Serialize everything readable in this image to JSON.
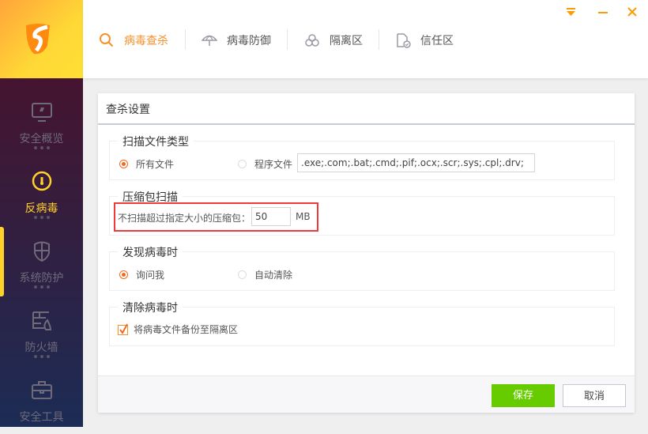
{
  "app": {
    "logo": "S shield logo"
  },
  "window_controls": {
    "menu_icon": "dropdown-menu-icon",
    "minimize_icon": "minimize-icon",
    "close_icon": "close-icon",
    "accent": "#ff9a00"
  },
  "top_tabs": [
    {
      "label": "病毒查杀",
      "icon": "search-icon",
      "active": true
    },
    {
      "label": "病毒防御",
      "icon": "umbrella-icon",
      "active": false
    },
    {
      "label": "隔离区",
      "icon": "biohazard-icon",
      "active": false
    },
    {
      "label": "信任区",
      "icon": "trusted-file-icon",
      "active": false
    }
  ],
  "sidebar": {
    "items": [
      {
        "label": "安全概览",
        "icon": "monitor-icon",
        "active": false
      },
      {
        "label": "反病毒",
        "icon": "gauge-icon",
        "active": true
      },
      {
        "label": "系统防护",
        "icon": "shield-icon",
        "active": false
      },
      {
        "label": "防火墙",
        "icon": "firewall-icon",
        "active": false
      },
      {
        "label": "安全工具",
        "icon": "toolbox-icon",
        "active": false
      }
    ]
  },
  "panel": {
    "title": "查杀设置",
    "scan_types": {
      "legend": "扫描文件类型",
      "option_all": "所有文件",
      "option_program": "程序文件",
      "selected": "所有文件",
      "extensions": ".exe;.com;.bat;.cmd;.pif;.ocx;.scr;.sys;.cpl;.drv;"
    },
    "archive": {
      "legend": "压缩包扫描",
      "label": "不扫描超过指定大小的压缩包：",
      "value": "50",
      "unit": "MB"
    },
    "on_found": {
      "legend": "发现病毒时",
      "option_ask": "询问我",
      "option_auto": "自动清除",
      "selected": "询问我"
    },
    "on_clean": {
      "legend": "清除病毒时",
      "backup_label": "将病毒文件备份至隔离区",
      "backup_checked": true
    },
    "save_label": "保存",
    "cancel_label": "取消"
  },
  "colors": {
    "accent": "#f7902a",
    "active_sidebar": "#ffd22a",
    "save": "#66cc00",
    "highlight_box": "#f03a3a"
  }
}
